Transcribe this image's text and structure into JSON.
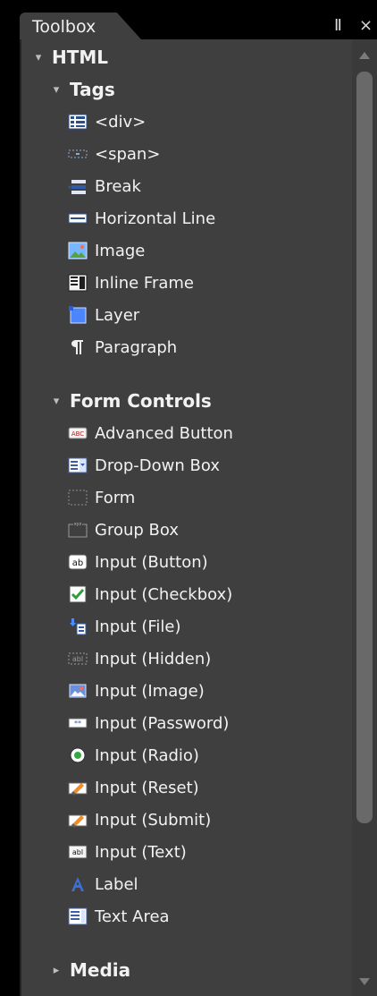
{
  "toolbox": {
    "title": "Toolbox",
    "pin_symbol": "Ⅱ",
    "close_symbol": "×"
  },
  "tree": {
    "html": {
      "label": "HTML",
      "expanded": true,
      "tags": {
        "label": "Tags",
        "expanded": true,
        "items": [
          {
            "label": "<div>",
            "icon": "div-icon"
          },
          {
            "label": "<span>",
            "icon": "span-icon"
          },
          {
            "label": "Break",
            "icon": "break-icon"
          },
          {
            "label": "Horizontal Line",
            "icon": "horizontal-line-icon"
          },
          {
            "label": "Image",
            "icon": "image-icon"
          },
          {
            "label": "Inline Frame",
            "icon": "inline-frame-icon"
          },
          {
            "label": "Layer",
            "icon": "layer-icon"
          },
          {
            "label": "Paragraph",
            "icon": "paragraph-icon"
          }
        ]
      },
      "form_controls": {
        "label": "Form Controls",
        "expanded": true,
        "items": [
          {
            "label": "Advanced Button",
            "icon": "advanced-button-icon"
          },
          {
            "label": "Drop-Down Box",
            "icon": "dropdown-box-icon"
          },
          {
            "label": "Form",
            "icon": "form-icon"
          },
          {
            "label": "Group Box",
            "icon": "group-box-icon"
          },
          {
            "label": "Input (Button)",
            "icon": "input-button-icon"
          },
          {
            "label": "Input (Checkbox)",
            "icon": "input-checkbox-icon"
          },
          {
            "label": "Input (File)",
            "icon": "input-file-icon"
          },
          {
            "label": "Input (Hidden)",
            "icon": "input-hidden-icon"
          },
          {
            "label": "Input (Image)",
            "icon": "input-image-icon"
          },
          {
            "label": "Input (Password)",
            "icon": "input-password-icon"
          },
          {
            "label": "Input (Radio)",
            "icon": "input-radio-icon"
          },
          {
            "label": "Input (Reset)",
            "icon": "input-reset-icon"
          },
          {
            "label": "Input (Submit)",
            "icon": "input-submit-icon"
          },
          {
            "label": "Input (Text)",
            "icon": "input-text-icon"
          },
          {
            "label": "Label",
            "icon": "label-icon"
          },
          {
            "label": "Text Area",
            "icon": "text-area-icon"
          }
        ]
      },
      "media": {
        "label": "Media",
        "expanded": false
      }
    }
  },
  "colors": {
    "panel_bg": "#3f3f3f",
    "frame_bg": "#000000",
    "text": "#f2f2f2"
  }
}
